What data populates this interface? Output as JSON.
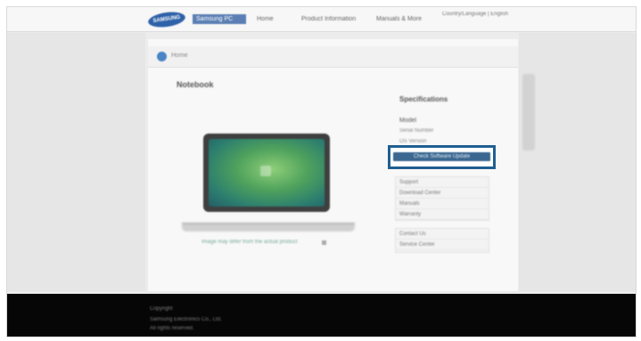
{
  "header": {
    "logo_text": "SAMSUNG",
    "brand_label": "Samsung PC",
    "nav": [
      "Home",
      "Product Information",
      "Manuals & More"
    ],
    "utility_text": "Country/Language | English"
  },
  "breadcrumb": {
    "label": "Home"
  },
  "product": {
    "title": "Notebook",
    "caption": "Image may differ from the actual product"
  },
  "specs": {
    "lines": [
      "Specifications",
      "Model",
      "Serial Number",
      "OS Version"
    ]
  },
  "cta": {
    "label": "Check Software Update"
  },
  "panels": {
    "first": [
      "Support",
      "Download Center",
      "Manuals",
      "Warranty"
    ],
    "second": [
      "Contact Us",
      "Service Center"
    ]
  },
  "footer": {
    "lines": [
      "Copyright",
      "Samsung Electronics Co., Ltd.",
      "All rights reserved."
    ]
  },
  "colors": {
    "accent": "#1f5f92",
    "button": "#3b6790",
    "footer_bg": "#060606"
  }
}
